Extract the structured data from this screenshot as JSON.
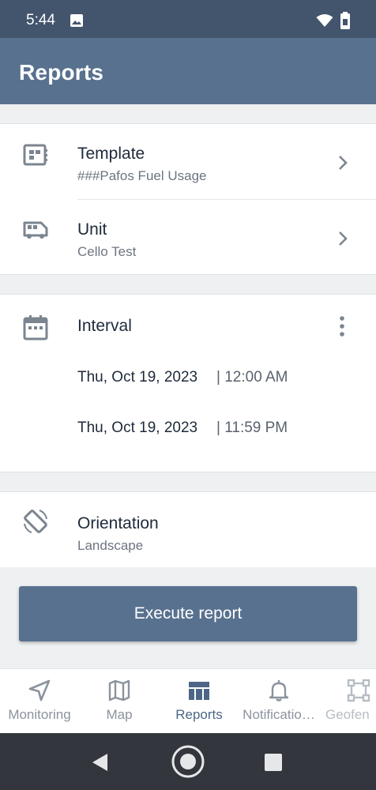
{
  "status": {
    "time": "5:44"
  },
  "header": {
    "title": "Reports"
  },
  "template": {
    "label": "Template",
    "value": "###Pafos Fuel Usage"
  },
  "unit": {
    "label": "Unit",
    "value": "Cello Test"
  },
  "interval": {
    "label": "Interval",
    "from_date": "Thu, Oct 19, 2023",
    "from_time": "| 12:00 AM",
    "to_date": "Thu, Oct 19, 2023",
    "to_time": "| 11:59 PM"
  },
  "orientation": {
    "label": "Orientation",
    "value": "Landscape"
  },
  "execute_label": "Execute report",
  "nav": {
    "items": [
      {
        "label": "Monitoring",
        "icon": "navigation-arrow-icon"
      },
      {
        "label": "Map",
        "icon": "map-icon"
      },
      {
        "label": "Reports",
        "icon": "reports-icon",
        "active": true
      },
      {
        "label": "Notificatio…",
        "icon": "bell-icon"
      },
      {
        "label": "Geofen",
        "icon": "geofence-icon"
      }
    ]
  },
  "colors": {
    "status_bar": "#43556d",
    "app_bar": "#58718f",
    "accent": "#4d6687",
    "background": "#eef0f2"
  }
}
